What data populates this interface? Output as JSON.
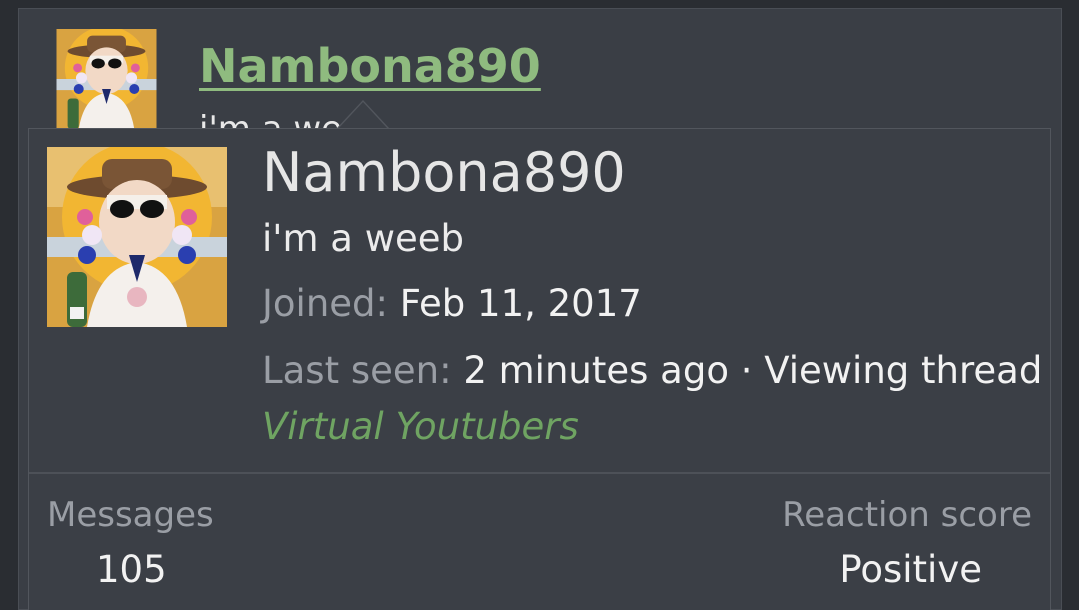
{
  "post": {
    "username": "Nambona890",
    "user_title": "i'm a weeb",
    "avatar_icon": "user-avatar-image"
  },
  "popup": {
    "username": "Nambona890",
    "user_title": "i'm a weeb",
    "joined_label": "Joined:",
    "joined_value": "Feb 11, 2017",
    "last_seen_label": "Last seen:",
    "last_seen_value": "2 minutes ago · Viewing thread",
    "viewing_link": "Virtual Youtubers",
    "stats": {
      "messages_label": "Messages",
      "messages_value": "105",
      "reaction_label": "Reaction score",
      "reaction_value": "Positive"
    }
  },
  "colors": {
    "background": "#2a2d32",
    "panel": "#3b3f46",
    "username_link": "#8fbb7f",
    "thread_link": "#6fa462",
    "muted_text": "#9a9ea5"
  }
}
